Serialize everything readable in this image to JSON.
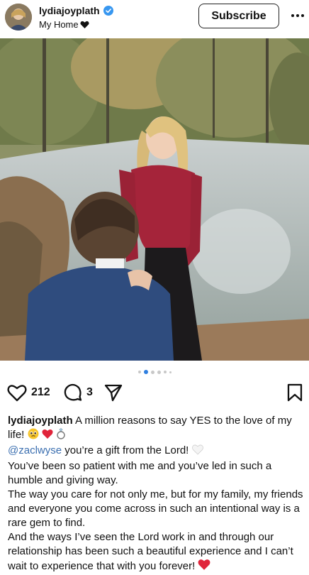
{
  "header": {
    "username": "lydiajoyplath",
    "subtitle": "My Home",
    "subscribe_label": "Subscribe"
  },
  "post": {
    "image_count": 6,
    "active_image": 2,
    "likes": "212",
    "comments": "3"
  },
  "caption": {
    "username": "lydiajoyplath",
    "line1": " A million reasons to say YES to the love of my life! ",
    "mention": "@zaclwyse",
    "line2": " you’re a gift from the Lord! ",
    "paragraph2": "You’ve been so patient with me and you’ve led in such a humble and giving way.",
    "paragraph3": "The way you care for not only me, but for my family, my friends and everyone you come across in such an intentional way is a rare gem to find.",
    "paragraph4": "And the ways I’ve seen the Lord work in and through our relationship has been such a beautiful experience and I can’t wait to experience that with you forever! "
  },
  "colors": {
    "verified": "#3897f0",
    "link": "#3b6fb0",
    "dot_active": "#2f7fe0",
    "heart_emoji": "#e0243a"
  }
}
